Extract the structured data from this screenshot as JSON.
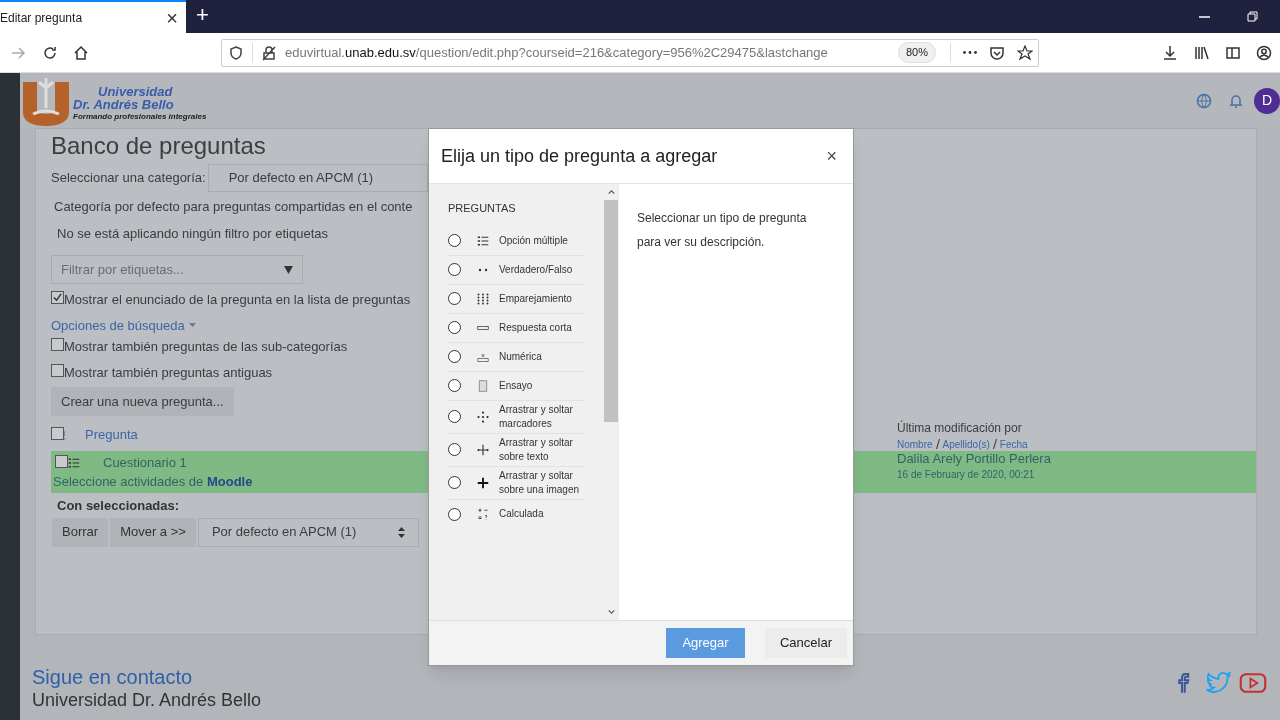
{
  "browser": {
    "tab_title": "Editar pregunta",
    "tab_close": "×",
    "new_tab": "+",
    "url_prefix": "eduvirtual.",
    "url_domain": "unab.edu.sv",
    "url_path": "/question/edit.php?courseid=216&category=956%2C29475&lastchange",
    "zoom": "80%"
  },
  "site": {
    "logo_line1": "Universidad",
    "logo_line2": "Dr. Andrés Bello",
    "logo_tagline": "Formando profesionales integrales",
    "avatar": "D"
  },
  "page": {
    "heading": "Banco de preguntas",
    "category_label": "Seleccionar una categoría:",
    "category_value": "Por defecto en APCM (1)",
    "category_info": "Categoría por defecto para preguntas compartidas en el conte",
    "filter_info": "No se está aplicando ningún filtro por etiquetas",
    "tag_filter": {
      "placeholder": "Filtrar por etiquetas..."
    },
    "show_text_option": {
      "label": "Mostrar el enunciado de la pregunta en la lista de preguntas",
      "checked": true
    },
    "search_options": "Opciones de búsqueda",
    "search_checkboxes": [
      {
        "label": "Mostrar también preguntas de las sub-categorías",
        "checked": false
      },
      {
        "label": "Mostrar también preguntas antiguas",
        "checked": false
      }
    ],
    "create_button": "Crear una nueva pregunta...",
    "columns": {
      "select_all_checked": false,
      "question": "Pregunta",
      "modified_title": "Última modificación por",
      "sort_links": [
        "Nombre",
        "Apellido(s)",
        "Fecha"
      ]
    },
    "rows": [
      {
        "name": "Cuestionario 1",
        "text": "Seleccione actividades de",
        "text_link": "Moodle",
        "modifier": "Dalila Arely Portillo Perlera",
        "date": "16 de February de 2020, 00:21",
        "checked": false,
        "selected": true
      }
    ],
    "with_selected": "Con seleccionadas:",
    "actions": [
      "Borrar",
      "Mover a >>"
    ],
    "move_target": "Por defecto en APCM (1)"
  },
  "footer": {
    "heading": "Sigue en contacto",
    "org": "Universidad Dr. Andrés Bello"
  },
  "modal": {
    "title": "Elija un tipo de pregunta a agregar",
    "close": "×",
    "section": "PREGUNTAS",
    "options": [
      {
        "label": "Opción múltiple",
        "kind": "multichoice",
        "selected": false
      },
      {
        "label": "Verdadero/Falso",
        "kind": "truefalse",
        "selected": false
      },
      {
        "label": "Emparejamiento",
        "kind": "match",
        "selected": false
      },
      {
        "label": "Respuesta corta",
        "kind": "shortanswer",
        "selected": false
      },
      {
        "label": "Numérica",
        "kind": "numerical",
        "selected": false
      },
      {
        "label": "Ensayo",
        "kind": "essay",
        "selected": false
      },
      {
        "label": "Arrastrar y soltar marcadores",
        "kind": "ddmarker",
        "selected": false
      },
      {
        "label": "Arrastrar y soltar sobre texto",
        "kind": "ddwtos",
        "selected": false
      },
      {
        "label": "Arrastrar y soltar sobre una imagen",
        "kind": "ddimage",
        "selected": false
      },
      {
        "label": "Calculada",
        "kind": "calculated",
        "selected": false
      }
    ],
    "description": "Seleccionar un tipo de pregunta para ver su descripción.",
    "buttons": [
      {
        "label": "Agregar",
        "kind": "primary"
      },
      {
        "label": "Cancelar",
        "kind": "secondary"
      }
    ]
  }
}
